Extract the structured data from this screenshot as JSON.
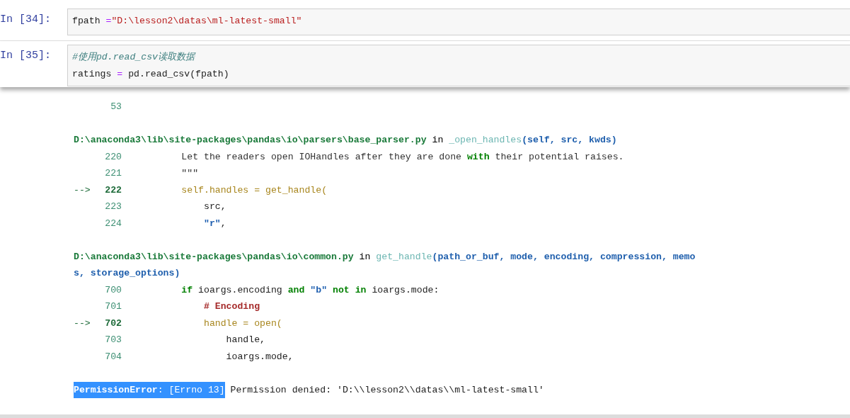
{
  "cells": [
    {
      "prompt": "In [34]:",
      "focused": false,
      "lines": [
        [
          {
            "text": "fpath ",
            "kind": "plain"
          },
          {
            "text": "=",
            "kind": "operator"
          },
          {
            "text": "\"D:\\lesson2\\datas\\ml-latest-small\"",
            "kind": "string"
          }
        ]
      ]
    },
    {
      "prompt": "In [35]:",
      "focused": true,
      "lines": [
        [
          {
            "text": "#使用pd.read_csv读取数据",
            "kind": "comment"
          }
        ],
        [
          {
            "text": "ratings ",
            "kind": "plain"
          },
          {
            "text": "=",
            "kind": "operator"
          },
          {
            "text": " pd.read_csv(fpath)",
            "kind": "plain"
          }
        ]
      ]
    }
  ],
  "output": {
    "frames": [
      {
        "lines": [
          {
            "number": "53",
            "current": false
          }
        ]
      },
      {
        "header": [
          [
            {
              "text": "D:\\anaconda3\\lib\\site-packages\\pandas\\io\\parsers\\base_parser.py",
              "kind": "path"
            },
            {
              "text": " in ",
              "kind": "plain"
            },
            {
              "text": "_open_handles",
              "kind": "func"
            },
            {
              "text": "(self, src, kwds)",
              "kind": "args"
            }
          ]
        ],
        "lines": [
          {
            "number": "220",
            "current": false,
            "code": [
              {
                "text": "        Let the readers open IOHandles after they are done ",
                "kind": "doc"
              },
              {
                "text": "with",
                "kind": "keyword"
              },
              {
                "text": " their potential raises.",
                "kind": "doc"
              }
            ]
          },
          {
            "number": "221",
            "current": false,
            "code": [
              {
                "text": "        \"\"\"",
                "kind": "doc"
              }
            ]
          },
          {
            "arrow": "-->",
            "number": "222",
            "current": true,
            "code": [
              {
                "text": "        self.handles = get_handle(",
                "kind": "call"
              }
            ]
          },
          {
            "number": "223",
            "current": false,
            "code": [
              {
                "text": "            src,",
                "kind": "plain"
              }
            ]
          },
          {
            "number": "224",
            "current": false,
            "code": [
              {
                "text": "            \"r\"",
                "kind": "string2"
              },
              {
                "text": ",",
                "kind": "plain"
              }
            ]
          }
        ]
      },
      {
        "header": [
          [
            {
              "text": "D:\\anaconda3\\lib\\site-packages\\pandas\\io\\common.py",
              "kind": "path"
            },
            {
              "text": " in ",
              "kind": "plain"
            },
            {
              "text": "get_handle",
              "kind": "func"
            },
            {
              "text": "(path_or_buf, mode, encoding, compression, memo",
              "kind": "args"
            }
          ],
          [
            {
              "text": "s, storage_options)",
              "kind": "args"
            }
          ]
        ],
        "lines": [
          {
            "number": "700",
            "current": false,
            "code": [
              {
                "text": "        if",
                "kind": "keyword"
              },
              {
                "text": " ioargs.encoding ",
                "kind": "plain"
              },
              {
                "text": "and",
                "kind": "keyword"
              },
              {
                "text": " \"b\"",
                "kind": "string2"
              },
              {
                "text": " not",
                "kind": "keyword"
              },
              {
                "text": " in",
                "kind": "keyword"
              },
              {
                "text": " ioargs.mode:",
                "kind": "plain"
              }
            ]
          },
          {
            "number": "701",
            "current": false,
            "code": [
              {
                "text": "            # Encoding",
                "kind": "hash"
              }
            ]
          },
          {
            "arrow": "-->",
            "number": "702",
            "current": true,
            "code": [
              {
                "text": "            handle = open(",
                "kind": "call"
              }
            ]
          },
          {
            "number": "703",
            "current": false,
            "code": [
              {
                "text": "                handle,",
                "kind": "plain"
              }
            ]
          },
          {
            "number": "704",
            "current": false,
            "code": [
              {
                "text": "                ioargs.mode,",
                "kind": "plain"
              }
            ]
          }
        ]
      }
    ],
    "error": {
      "name": "PermissionError",
      "errno": ": [Errno 13]",
      "highlighted": true,
      "message": " Permission denied: 'D:\\\\lesson2\\\\datas\\\\ml-latest-small'"
    }
  }
}
